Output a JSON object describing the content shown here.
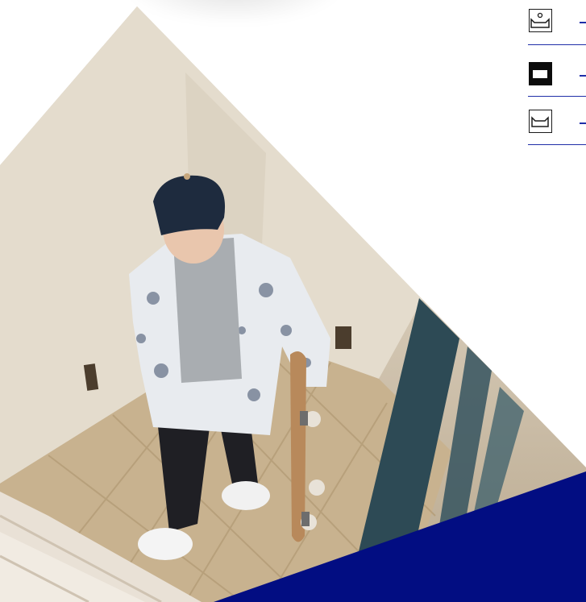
{
  "hero": {
    "image": "person-carrying-skateboard-on-stairs",
    "accent_color": "#020d82"
  },
  "legend": {
    "items": [
      {
        "icon": "framed-box-with-circle-icon"
      },
      {
        "icon": "filled-black-box-icon"
      },
      {
        "icon": "framed-box-outline-icon"
      }
    ],
    "rule_color": "#1f2ea8"
  }
}
